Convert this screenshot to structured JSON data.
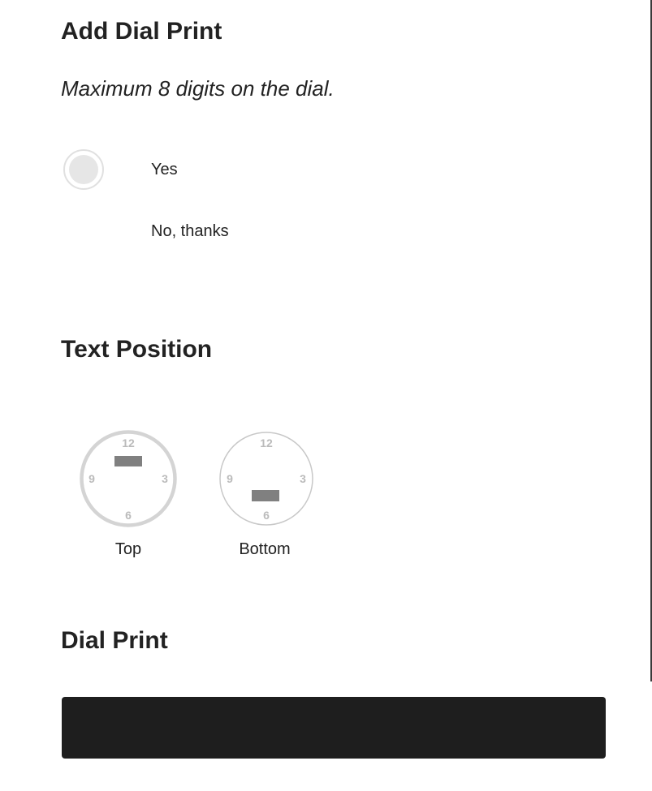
{
  "sections": {
    "add_dial_print": {
      "title": "Add Dial Print",
      "note": "Maximum 8 digits on the dial.",
      "options": [
        {
          "label": "Yes"
        },
        {
          "label": "No, thanks"
        }
      ]
    },
    "text_position": {
      "title": "Text Position",
      "options": [
        {
          "label": "Top",
          "numerals": [
            "12",
            "3",
            "6",
            "9"
          ],
          "selected": true
        },
        {
          "label": "Bottom",
          "numerals": [
            "12",
            "3",
            "6",
            "9"
          ],
          "selected": false
        }
      ]
    },
    "dial_print": {
      "title": "Dial Print",
      "input_value": "",
      "input_placeholder": ""
    }
  },
  "colors": {
    "input_background": "#1e1e1e",
    "dial_outline_selected": "#d4d4d4",
    "dial_outline": "#c8c8c8",
    "text_marker": "#808080",
    "numerals": "#bbbbbb"
  }
}
